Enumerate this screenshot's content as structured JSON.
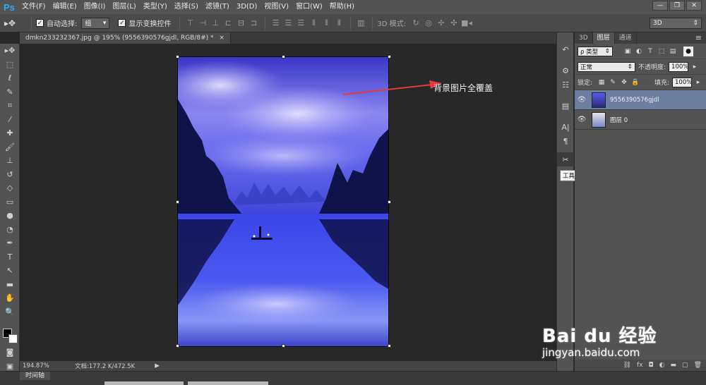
{
  "app": {
    "logo": "Ps",
    "menu": [
      "文件(F)",
      "编辑(E)",
      "图像(I)",
      "图层(L)",
      "类型(Y)",
      "选择(S)",
      "滤镜(T)",
      "3D(D)",
      "视图(V)",
      "窗口(W)",
      "帮助(H)"
    ],
    "window_buttons": [
      "—",
      "❐",
      "✕"
    ]
  },
  "options_bar": {
    "auto_select_label": "自动选择:",
    "auto_select_value": "组",
    "show_transform_label": "显示变换控件",
    "mode_3d_label": "3D 模式:",
    "workspace_value": "3D"
  },
  "document": {
    "tab_title": "dmkn233232367.jpg @ 195% (9556390576gjdl, RGB/8#) *",
    "tab_close": "×"
  },
  "canvas": {
    "annotation": "背景图片全覆盖"
  },
  "status": {
    "zoom": "194.87%",
    "doc_info": "文档:177.2 K/472.5K"
  },
  "timeline": {
    "tab_label": "时间轴"
  },
  "tooltip": "工具预设",
  "layers_panel": {
    "tabs": [
      "3D",
      "图层",
      "通道"
    ],
    "filter_label": "ρ 类型",
    "blend_mode": "正常",
    "opacity_label": "不透明度:",
    "opacity_value": "100%",
    "lock_label": "锁定:",
    "fill_label": "填充:",
    "fill_value": "100%",
    "layers": [
      {
        "name": "9556390576gjdl",
        "selected": true
      },
      {
        "name": "图层 0",
        "selected": false
      }
    ]
  },
  "watermark": {
    "brand": "Bai du 经验",
    "url": "jingyan.baidu.com"
  }
}
